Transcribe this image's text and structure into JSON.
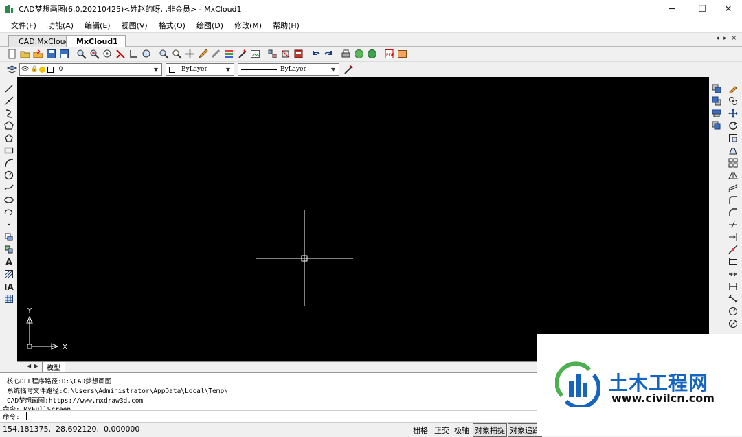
{
  "window": {
    "title": "CAD梦想画图(6.0.20210425)<姓赵的呀, ,非会员> - MxCloud1",
    "minimize": "─",
    "maximize": "☐",
    "close": "✕"
  },
  "menu": [
    "文件(F)",
    "功能(A)",
    "编辑(E)",
    "视图(V)",
    "格式(O)",
    "绘图(D)",
    "修改(M)",
    "帮助(H)"
  ],
  "doc_tabs": [
    {
      "label": "CAD.MxCloud",
      "active": false
    },
    {
      "label": "MxCloud1",
      "active": true
    }
  ],
  "tab_nav": "◂ ▸ ×",
  "properties": {
    "layer": "0",
    "color": "ByLayer",
    "linetype": "ByLayer"
  },
  "ucs": {
    "x_label": "X",
    "y_label": "Y"
  },
  "layout_tab": "模型",
  "command_lines": [
    "核心DLL程序路径:D:\\CAD梦想画图",
    "系统临时文件路径:C:\\Users\\Administrator\\AppData\\Local\\Temp\\",
    "CAD梦想画图:https://www.mxdraw3d.com",
    "命令: MxFullScreen"
  ],
  "command_prompt": "命令:",
  "status": {
    "coords": "154.181375,  28.692120,  0.000000",
    "toggles": [
      "栅格",
      "正交",
      "极轴",
      "对象捕捉",
      "对象追踪"
    ]
  },
  "watermark": {
    "name": "土木工程网",
    "url": "www.civilcn.com"
  },
  "colors": {
    "canvas": "#000000",
    "crosshair": "#ffffff",
    "watermark_blue": "#1565c0",
    "watermark_green": "#4caf50"
  }
}
